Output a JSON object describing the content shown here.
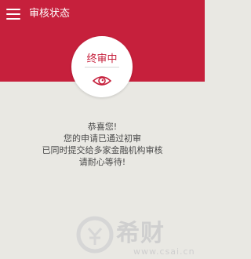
{
  "header": {
    "title": "审核状态",
    "menu_icon": "hamburger-menu-icon"
  },
  "status": {
    "label": "终审中",
    "icon": "eye-icon"
  },
  "message": {
    "lines": [
      "恭喜您!",
      "您的申请已通过初审",
      "已同时提交给多家金融机构审核",
      "请耐心等待!"
    ]
  },
  "watermark": {
    "brand": "希财",
    "url": "www.csai.cn"
  },
  "colors": {
    "primary": "#c6203c",
    "background": "#e9e8e3",
    "text": "#4a4a4a"
  }
}
